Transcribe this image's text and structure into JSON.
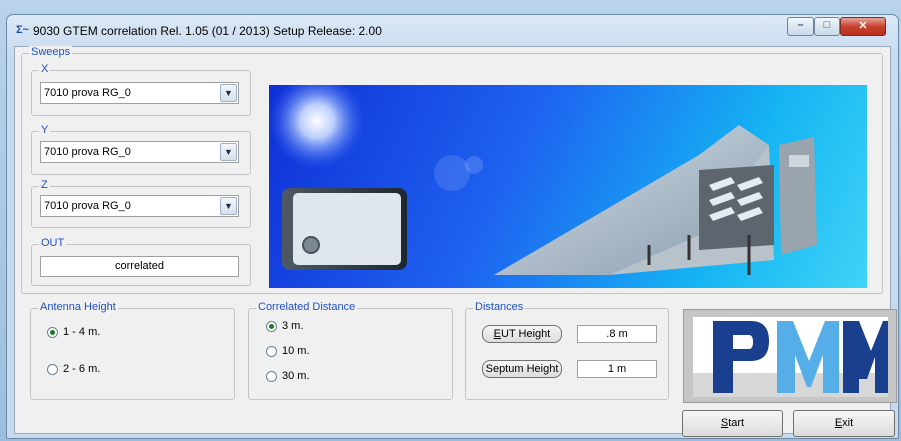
{
  "window": {
    "title": "9030 GTEM correlation Rel. 1.05 (01 / 2013)   Setup Release: 2.00",
    "app_icon": "sigma-icon",
    "controls": {
      "minimize": "–",
      "maximize": "□",
      "close": "✕"
    }
  },
  "sweeps": {
    "legend": "Sweeps",
    "x": {
      "label": "X",
      "value": "7010 prova RG_0"
    },
    "y": {
      "label": "Y",
      "value": "7010 prova RG_0"
    },
    "z": {
      "label": "Z",
      "value": "7010 prova RG_0"
    },
    "out": {
      "label": "OUT",
      "value": "correlated"
    }
  },
  "antenna_height": {
    "legend": "Antenna Height",
    "options": [
      {
        "label": "1 - 4 m.",
        "selected": true
      },
      {
        "label": "2 - 6 m.",
        "selected": false
      }
    ]
  },
  "correlated_distance": {
    "legend": "Correlated Distance",
    "options": [
      {
        "label": "3 m.",
        "selected": true
      },
      {
        "label": "10 m.",
        "selected": false
      },
      {
        "label": "30 m.",
        "selected": false
      }
    ]
  },
  "distances": {
    "legend": "Distances",
    "eut_height": {
      "button_pre": "",
      "button_key": "E",
      "button_post": "UT Height",
      "value": ".8 m"
    },
    "septum_height": {
      "button": "Septum Height",
      "value": "1 m"
    }
  },
  "buttons": {
    "start": {
      "key": "S",
      "rest": "tart"
    },
    "exit": {
      "key": "E",
      "rest": "xit"
    }
  },
  "colors": {
    "accent": "#1f52c4",
    "logo_blue": "#1a3f8f",
    "logo_sky": "#56aee8"
  }
}
